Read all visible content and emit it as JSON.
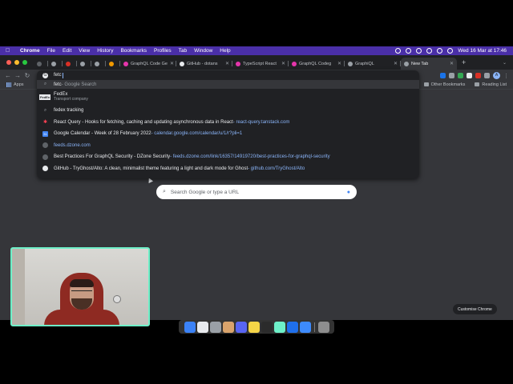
{
  "menubar": {
    "app": "Chrome",
    "items": [
      "File",
      "Edit",
      "View",
      "History",
      "Bookmarks",
      "Profiles",
      "Tab",
      "Window",
      "Help"
    ],
    "clock": "Wed 16 Mar at  17:46"
  },
  "tabs": [
    {
      "label": "",
      "fav_color": "#5f6368",
      "size": "small"
    },
    {
      "label": "",
      "fav_color": "#9aa0a6",
      "size": "small"
    },
    {
      "label": "",
      "fav_color": "#d93025",
      "size": "small"
    },
    {
      "label": "",
      "fav_color": "#9aa0a6",
      "size": "small"
    },
    {
      "label": "",
      "fav_color": "#9aa0a6",
      "size": "small"
    },
    {
      "label": "",
      "fav_color": "#f29900",
      "size": "small"
    },
    {
      "label": "GraphQL Code Ge",
      "fav_color": "#e535ab",
      "size": "med"
    },
    {
      "label": "GitHub - dotans",
      "fav_color": "#e8eaed",
      "size": "med"
    },
    {
      "label": "TypeScript React",
      "fav_color": "#e535ab",
      "size": "med"
    },
    {
      "label": "GraphQL Codeg",
      "fav_color": "#e535ab",
      "size": "med"
    },
    {
      "label": "GraphiQL",
      "fav_color": "#9aa0a6",
      "size": "med"
    }
  ],
  "active_tab": {
    "label": "New Tab"
  },
  "bookmarks": {
    "apps_label": "Apps",
    "other": "Other Bookmarks",
    "reading": "Reading List"
  },
  "omnibox": {
    "typed": "fetc",
    "suggestions": {
      "first": {
        "title": "fetc",
        "suffix": " - Google Search"
      },
      "fedex": {
        "logo": "FedEx",
        "title": "FedEx",
        "subtitle": "Transport company"
      },
      "tracking": {
        "title": "fedex tracking"
      },
      "react_query": {
        "title": "React Query - Hooks for fetching, caching and updating asynchronous data in React",
        "url": " - react-query.tanstack.com"
      },
      "calendar": {
        "title": "Google Calendar - Week of 28 February 2022",
        "url": " - calendar.google.com/calendar/u/1/r?pli=1"
      },
      "dzone": {
        "url": "feeds.dzone.com"
      },
      "graphql_sec": {
        "title": "Best Practices For GraphQL Security - DZone Security",
        "url": " - feeds.dzone.com/link/16357/14919720/best-practices-for-graphql-security"
      },
      "github": {
        "title": "GitHub - TryGhost/Alto: A clean, minimalist theme featuring a light and dark mode for Ghost",
        "url": " - github.com/TryGhost/Alto"
      }
    }
  },
  "ntp": {
    "search_placeholder": "Search Google or type a URL",
    "customise": "Customise Chrome"
  },
  "colors": {
    "menubar": "#4a2fa8",
    "accent_blue": "#8ab4f8",
    "chrome_dark": "#35363a",
    "webcam_border": "#6ef0c8"
  },
  "dock_icons": [
    "#3b82f6",
    "#e8eaed",
    "#9aa0a6",
    "#d9a36b",
    "#5865f2",
    "#f5d547",
    "#2b2b2b",
    "#6ef0c8",
    "#1f6feb",
    "#3d8bfd",
    "#8e8e8e"
  ]
}
